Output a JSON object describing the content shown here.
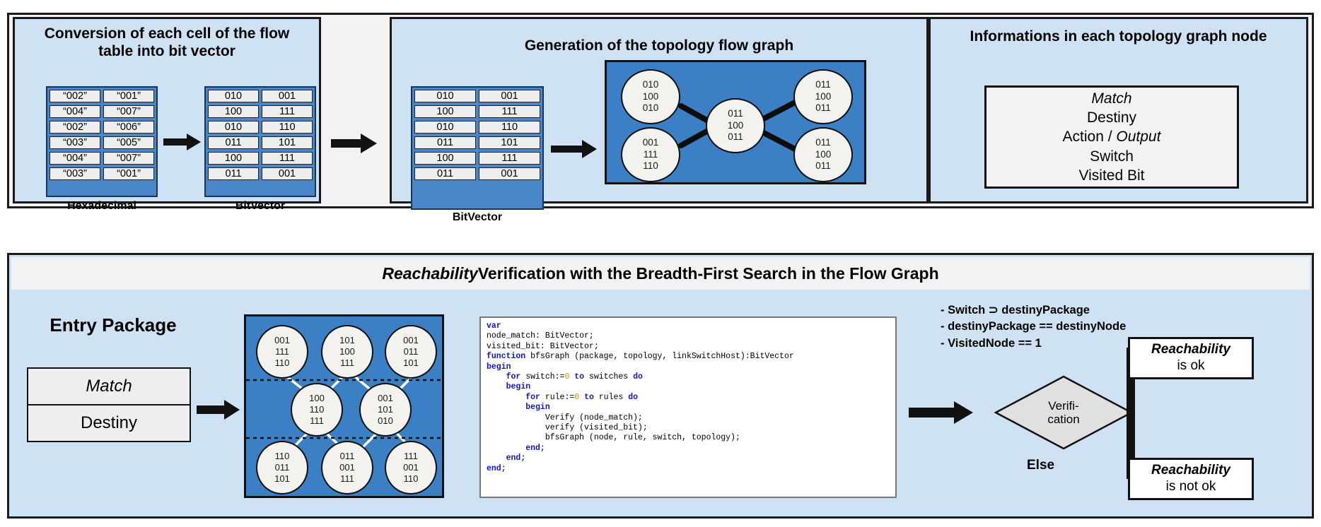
{
  "panels": {
    "conversion": {
      "title": "Conversion of each cell of the flow table into bit vector",
      "hex_caption": "Hexadecimal",
      "bitvector_caption": "BitVector",
      "hex_rows": [
        [
          "“002”",
          "“001”"
        ],
        [
          "“004”",
          "“007”"
        ],
        [
          "“002”",
          "“006”"
        ],
        [
          "“003”",
          "“005”"
        ],
        [
          "“004”",
          "“007”"
        ],
        [
          "“003”",
          "“001”"
        ]
      ],
      "bit_rows": [
        [
          "010",
          "001"
        ],
        [
          "100",
          "111"
        ],
        [
          "010",
          "110"
        ],
        [
          "011",
          "101"
        ],
        [
          "100",
          "111"
        ],
        [
          "011",
          "001"
        ]
      ]
    },
    "topology": {
      "title": "Generation of the topology flow graph",
      "bitvector_caption": "BitVector",
      "bit_rows": [
        [
          "010",
          "001"
        ],
        [
          "100",
          "111"
        ],
        [
          "010",
          "110"
        ],
        [
          "011",
          "101"
        ],
        [
          "100",
          "111"
        ],
        [
          "011",
          "001"
        ]
      ],
      "graph_nodes": [
        {
          "id": "n1",
          "lines": [
            "010",
            "100",
            "010"
          ]
        },
        {
          "id": "n2",
          "lines": [
            "001",
            "111",
            "110"
          ]
        },
        {
          "id": "n3",
          "lines": [
            "011",
            "100",
            "011"
          ]
        },
        {
          "id": "n4",
          "lines": [
            "011",
            "100",
            "011"
          ]
        },
        {
          "id": "n5",
          "lines": [
            "011",
            "100",
            "011"
          ]
        }
      ]
    },
    "node_info": {
      "title": "Informations in each topology graph node",
      "lines": [
        {
          "text": "Match",
          "style": "italic"
        },
        {
          "text": "Destiny",
          "style": "normal"
        },
        {
          "text": "Action / Output",
          "style": "mixed"
        },
        {
          "text": "Switch",
          "style": "normal"
        },
        {
          "text": "Visited Bit",
          "style": "normal"
        }
      ],
      "action_prefix": "Action / ",
      "action_italic": "Output"
    },
    "reachability": {
      "band_title_italic": "Reachability",
      "band_title_rest": " Verification with the  Breadth-First Search in the Flow Graph",
      "entry_title": "Entry Package",
      "entry_rows": [
        {
          "text": "Match",
          "style": "italic"
        },
        {
          "text": "Destiny",
          "style": "normal"
        }
      ],
      "bfs_nodes": [
        {
          "lines": [
            "001",
            "111",
            "110"
          ]
        },
        {
          "lines": [
            "101",
            "100",
            "111"
          ]
        },
        {
          "lines": [
            "001",
            "011",
            "101"
          ]
        },
        {
          "lines": [
            "100",
            "110",
            "111"
          ]
        },
        {
          "lines": [
            "001",
            "101",
            "010"
          ]
        },
        {
          "lines": [
            "110",
            "011",
            "101"
          ]
        },
        {
          "lines": [
            "011",
            "001",
            "111"
          ]
        },
        {
          "lines": [
            "111",
            "001",
            "110"
          ]
        }
      ],
      "code_lines": [
        [
          {
            "t": "var",
            "c": "kw"
          }
        ],
        [
          {
            "t": "node_match: BitVector;",
            "c": ""
          }
        ],
        [
          {
            "t": "visited_bit: BitVector;",
            "c": ""
          }
        ],
        [
          {
            "t": "function",
            "c": "kw"
          },
          {
            "t": " bfsGraph (package, topology, linkSwitchHost):BitVector",
            "c": ""
          }
        ],
        [
          {
            "t": "begin",
            "c": "kw"
          }
        ],
        [
          {
            "t": "    ",
            "c": ""
          },
          {
            "t": "for",
            "c": "kw"
          },
          {
            "t": " switch:=",
            "c": ""
          },
          {
            "t": "0",
            "c": "num"
          },
          {
            "t": " ",
            "c": ""
          },
          {
            "t": "to",
            "c": "kw"
          },
          {
            "t": " switches ",
            "c": ""
          },
          {
            "t": "do",
            "c": "kw"
          }
        ],
        [
          {
            "t": "    ",
            "c": ""
          },
          {
            "t": "begin",
            "c": "kw"
          }
        ],
        [
          {
            "t": "        ",
            "c": ""
          },
          {
            "t": "for",
            "c": "kw"
          },
          {
            "t": " rule:=",
            "c": ""
          },
          {
            "t": "0",
            "c": "num"
          },
          {
            "t": " ",
            "c": ""
          },
          {
            "t": "to",
            "c": "kw"
          },
          {
            "t": " rules ",
            "c": ""
          },
          {
            "t": "do",
            "c": "kw"
          }
        ],
        [
          {
            "t": "        ",
            "c": ""
          },
          {
            "t": "begin",
            "c": "kw"
          }
        ],
        [
          {
            "t": "            Verify (node_match);",
            "c": ""
          }
        ],
        [
          {
            "t": "            verify (visited_bit);",
            "c": ""
          }
        ],
        [
          {
            "t": "            bfsGraph (node, rule, switch, topology);",
            "c": ""
          }
        ],
        [
          {
            "t": "        ",
            "c": ""
          },
          {
            "t": "end;",
            "c": "kw"
          }
        ],
        [
          {
            "t": "    ",
            "c": ""
          },
          {
            "t": "end;",
            "c": "kw"
          }
        ],
        [
          {
            "t": "end;",
            "c": "kw"
          }
        ]
      ],
      "conditions": [
        "- Switch ⊃ destinyPackage",
        "- destinyPackage == destinyNode",
        "- VisitedNode == 1"
      ],
      "decision_label_line1": "Verifi-",
      "decision_label_line2": "cation",
      "else_label": "Else",
      "result_ok": {
        "line1": "Reachability",
        "line2": "is ok"
      },
      "result_not_ok": {
        "line1": "Reachability",
        "line2": "is not ok"
      }
    }
  },
  "colors": {
    "panel_bg": "#cfe2f3",
    "table_blue": "#4a86c8",
    "graph_blue": "#3b7fc4",
    "node_fill": "#f4f2ee",
    "frame": "#1a1a1a",
    "code_keyword": "#1414c8",
    "code_number": "#d98f00",
    "diamond_fill": "#e0e0e0"
  }
}
